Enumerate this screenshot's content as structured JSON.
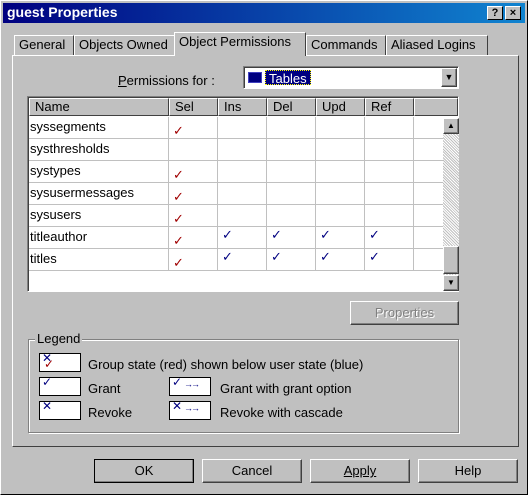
{
  "window": {
    "title": "guest Properties",
    "help_btn": "?",
    "close_btn": "×"
  },
  "tabs": [
    "General",
    "Objects Owned",
    "Object Permissions",
    "Commands",
    "Aliased Logins"
  ],
  "permissions_for": {
    "label_prefix": "",
    "label_underlined": "P",
    "label_rest": "ermissions for :",
    "selected": "Tables"
  },
  "grid": {
    "columns": [
      "Name",
      "Sel",
      "Ins",
      "Del",
      "Upd",
      "Ref"
    ],
    "rows": [
      {
        "name": "syssegments",
        "sel": "✓",
        "ins": "",
        "del": "",
        "upd": "",
        "ref": ""
      },
      {
        "name": "systhresholds",
        "sel": "",
        "ins": "",
        "del": "",
        "upd": "",
        "ref": ""
      },
      {
        "name": "systypes",
        "sel": "✓",
        "ins": "",
        "del": "",
        "upd": "",
        "ref": ""
      },
      {
        "name": "sysusermessages",
        "sel": "✓",
        "ins": "",
        "del": "",
        "upd": "",
        "ref": ""
      },
      {
        "name": "sysusers",
        "sel": "✓",
        "ins": "",
        "del": "",
        "upd": "",
        "ref": ""
      },
      {
        "name": "titleauthor",
        "sel": "✓",
        "ins": "✓",
        "del": "✓",
        "upd": "✓",
        "ref": "✓"
      },
      {
        "name": "titles",
        "sel": "✓",
        "ins": "✓",
        "del": "✓",
        "upd": "✓",
        "ref": "✓"
      }
    ]
  },
  "properties_button": "Properties",
  "legend": {
    "title": "Legend",
    "group_state": "Group state (red) shown below user state (blue)",
    "grant": "Grant",
    "revoke": "Revoke",
    "grant_with_option": "Grant with grant option",
    "revoke_cascade": "Revoke with cascade"
  },
  "buttons": {
    "ok": "OK",
    "cancel": "Cancel",
    "apply": "Apply",
    "help": "Help"
  },
  "colors": {
    "title_bar": "#000080",
    "group_check": "#a00000",
    "user_check": "#000080"
  }
}
